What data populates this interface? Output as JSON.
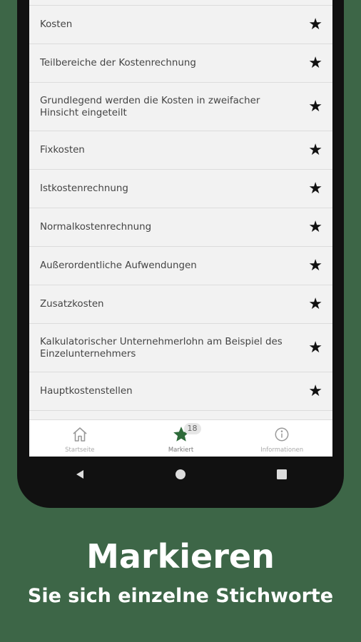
{
  "list": {
    "items": [
      {
        "label": "Kosten"
      },
      {
        "label": "Teilbereiche der Kostenrechnung"
      },
      {
        "label": "Grundlegend werden die Kosten in zweifacher Hinsicht eingeteilt"
      },
      {
        "label": "Fixkosten"
      },
      {
        "label": "Istkostenrechnung"
      },
      {
        "label": "Normalkostenrechnung"
      },
      {
        "label": "Außerordentliche Aufwendungen"
      },
      {
        "label": "Zusatzkosten"
      },
      {
        "label": "Kalkulatorischer Unternehmerlohn am Beispiel des Einzelunternehmers"
      },
      {
        "label": "Hauptkostenstellen"
      }
    ],
    "star_glyph": "★"
  },
  "bottom_nav": {
    "items": [
      {
        "label": "Startseite",
        "icon": "home-icon"
      },
      {
        "label": "Markiert",
        "icon": "star-icon",
        "badge": "18",
        "active": true
      },
      {
        "label": "Informationen",
        "icon": "info-icon"
      }
    ]
  },
  "system_nav": [
    "back-icon",
    "home-circle-icon",
    "recents-icon"
  ],
  "promo": {
    "headline": "Markieren",
    "subline": "Sie sich einzelne Stichworte"
  },
  "colors": {
    "background": "#3d6647",
    "accent_star": "#2e6b3a"
  }
}
